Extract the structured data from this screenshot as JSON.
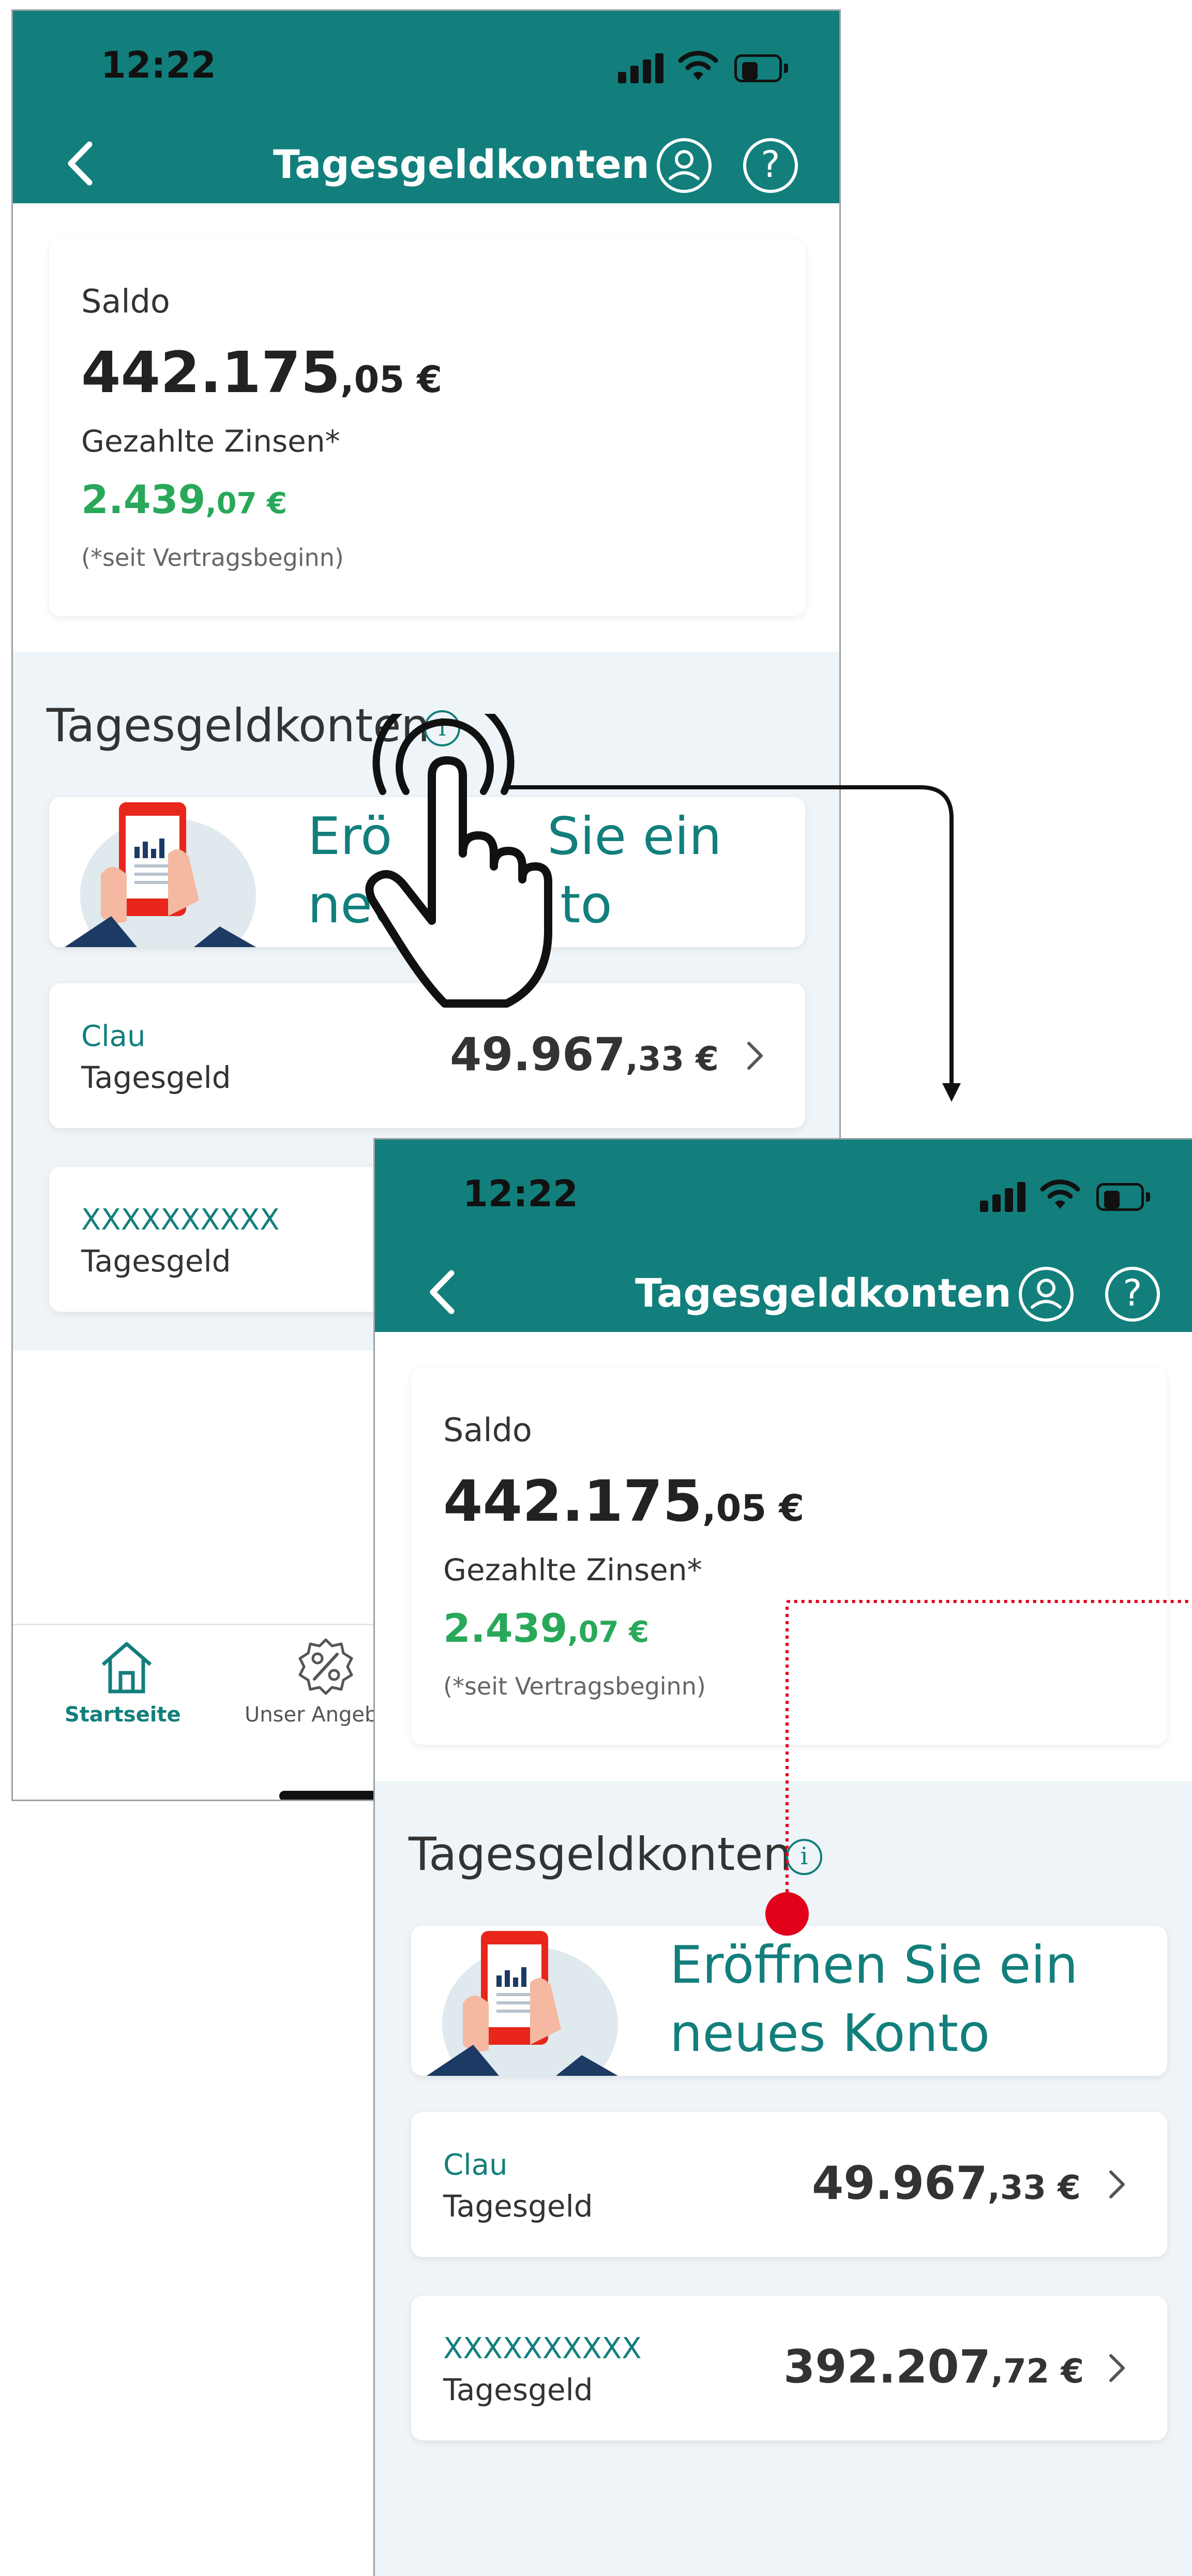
{
  "status_bar": {
    "time": "12:22"
  },
  "header": {
    "title": "Tagesgeldkonten",
    "help_symbol": "?"
  },
  "balance_card": {
    "saldo_label": "Saldo",
    "saldo_main": "442.175",
    "saldo_decimal": ",05 €",
    "interest_label": "Gezahlte Zinsen*",
    "interest_main": "2.439",
    "interest_decimal": ",07 €",
    "interest_note": "(*seit Vertragsbeginn)"
  },
  "section": {
    "title": "Tagesgeldkonten",
    "info_symbol": "i"
  },
  "promo": {
    "line1": "Eröffnen Sie ein",
    "line2": "neues Konto"
  },
  "accounts": [
    {
      "name": "Clau",
      "type": "Tagesgeld",
      "amount_main": "49.967",
      "amount_decimal": ",33 €"
    },
    {
      "name": "XXXXXXXXXX",
      "type": "Tagesgeld",
      "amount_main": "392.207",
      "amount_decimal": ",72 €"
    }
  ],
  "tabbar": {
    "home_label": "Startseite",
    "offer_label": "Unser Angeb"
  },
  "overlay_promo_partial": {
    "line1_start": "Erö",
    "line1_end": "Sie ein",
    "line2_start": "neu",
    "line2_end": "to"
  },
  "colors": {
    "brand": "#127f7c",
    "green": "#29a85a",
    "annotation_red": "#e3001b"
  },
  "annotations": {
    "tap_gesture_icon": "hand-pointer-icon"
  }
}
